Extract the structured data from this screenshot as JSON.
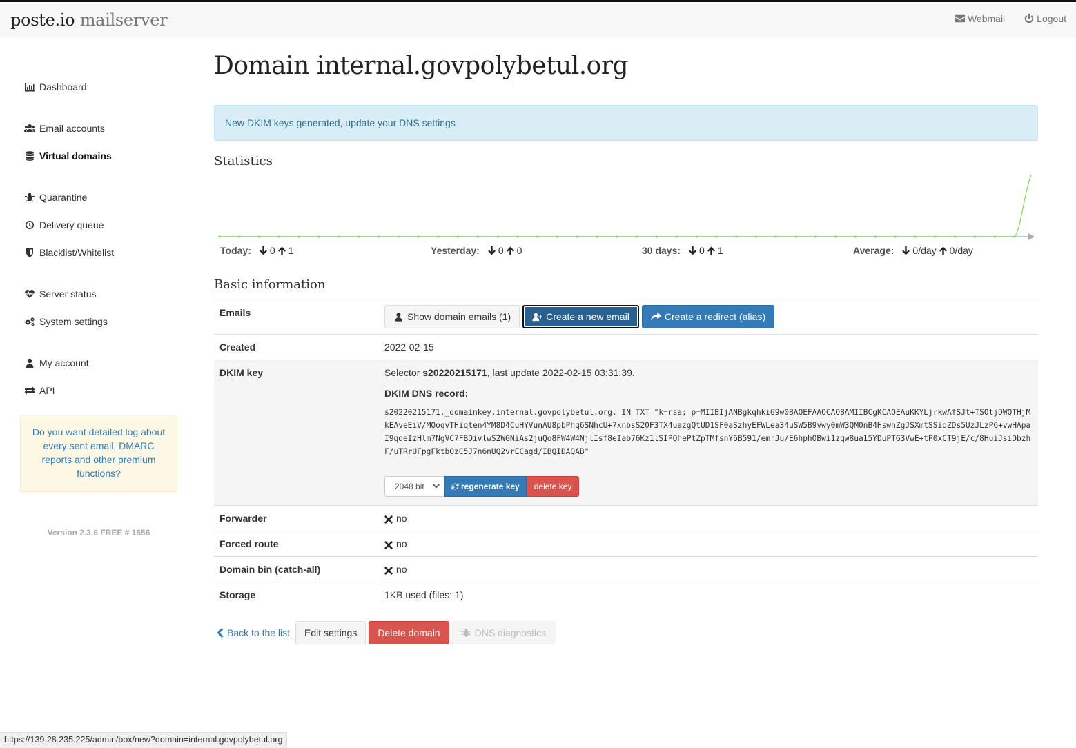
{
  "navbar": {
    "brand_main": "poste.io",
    "brand_sub": "mailserver",
    "webmail": "Webmail",
    "logout": "Logout"
  },
  "sidebar": {
    "items": [
      {
        "label": "Dashboard",
        "icon": "bar-chart-icon"
      },
      {
        "label": "Email accounts",
        "icon": "users-icon"
      },
      {
        "label": "Virtual domains",
        "icon": "database-icon",
        "active": true
      },
      {
        "label": "Quarantine",
        "icon": "bug-icon"
      },
      {
        "label": "Delivery queue",
        "icon": "clock-icon"
      },
      {
        "label": "Blacklist/Whitelist",
        "icon": "shield-icon"
      },
      {
        "label": "Server status",
        "icon": "heartbeat-icon"
      },
      {
        "label": "System settings",
        "icon": "gears-icon"
      },
      {
        "label": "My account",
        "icon": "user-icon"
      },
      {
        "label": "API",
        "icon": "exchange-icon"
      }
    ],
    "promo": "Do you want detailed log about every sent email, DMARC reports and other premium functions?",
    "version": "Version 2.3.6 FREE # 1656"
  },
  "main": {
    "title": "Domain internal.govpolybetul.org",
    "alert": "New DKIM keys generated, update your DNS settings",
    "statistics_title": "Statistics",
    "stats": [
      {
        "label": "Today:",
        "down": "0",
        "up": "1"
      },
      {
        "label": "Yesterday:",
        "down": "0",
        "up": "0"
      },
      {
        "label": "30 days:",
        "down": "0",
        "up": "1"
      },
      {
        "label": "Average:",
        "down": "0/day",
        "up": "0/day"
      }
    ],
    "basic_title": "Basic information",
    "emails": {
      "label": "Emails",
      "show_btn": "Show domain emails (",
      "show_count": "1",
      "show_btn_end": ")",
      "create_btn": "Create a new email",
      "redirect_btn": "Create a redirect (alias)"
    },
    "created": {
      "label": "Created",
      "value": "2022-02-15"
    },
    "dkim": {
      "label": "DKIM key",
      "selector_prefix": "Selector ",
      "selector": "s20220215171",
      "selector_suffix": ", last update 2022-02-15 03:31:39.",
      "record_title": "DKIM DNS record:",
      "record": "s20220215171._domainkey.internal.govpolybetul.org. IN TXT \"k=rsa; p=MIIBIjANBgkqhkiG9w0BAQEFAAOCAQ8AMIIBCgKCAQEAuKKYLjrkwAfSJt+TSOtjDWQTHjMkEAveEiV/MOoqvTHiqten4YM8D4CuHYVunAU8pbPhq6SNhcU+7xnbsS20F3TX4uazgQtUD1SF0aSzhyEFWLea34uSW5B9vwy0mW3QM0nB4HswhZgJSXmtSSiqZDs5UzJLzP6+vwHApaI9qdeIzHlm7NgVC7FBDivlwS2WGNiAs2juQo8FW4W4NjlIsf8eIab76Kz1lSIPQhePtZpTMfsnY6B591/emrJu/E6hphOBwi1zqw8ua15YDuPTG3VwE+tP0xCT9jE/c/8HuiJsiDbzhF/uTRrUFpgFktbOzC5J7n6nUQ2vrECagd/IBQIDAQAB\"",
      "bits": "2048 bit",
      "regenerate": "regenerate key",
      "delete": "delete key"
    },
    "forwarder": {
      "label": "Forwarder",
      "value": "no"
    },
    "forced_route": {
      "label": "Forced route",
      "value": "no"
    },
    "domain_bin": {
      "label": "Domain bin (catch-all)",
      "value": "no"
    },
    "storage": {
      "label": "Storage",
      "value": "1KB used (files: 1)"
    },
    "actions": {
      "back": "Back to the list",
      "edit": "Edit settings",
      "delete": "Delete domain",
      "dns": "DNS diagnostics"
    }
  },
  "statusbar": "https://139.28.235.225/admin/box/new?domain=internal.govpolybetul.org",
  "colors": {
    "primary": "#337ab7",
    "danger": "#d9534f",
    "chart_line": "#8cd25a",
    "chart_axis": "#92c6c2",
    "alert_bg": "#d9edf7"
  }
}
